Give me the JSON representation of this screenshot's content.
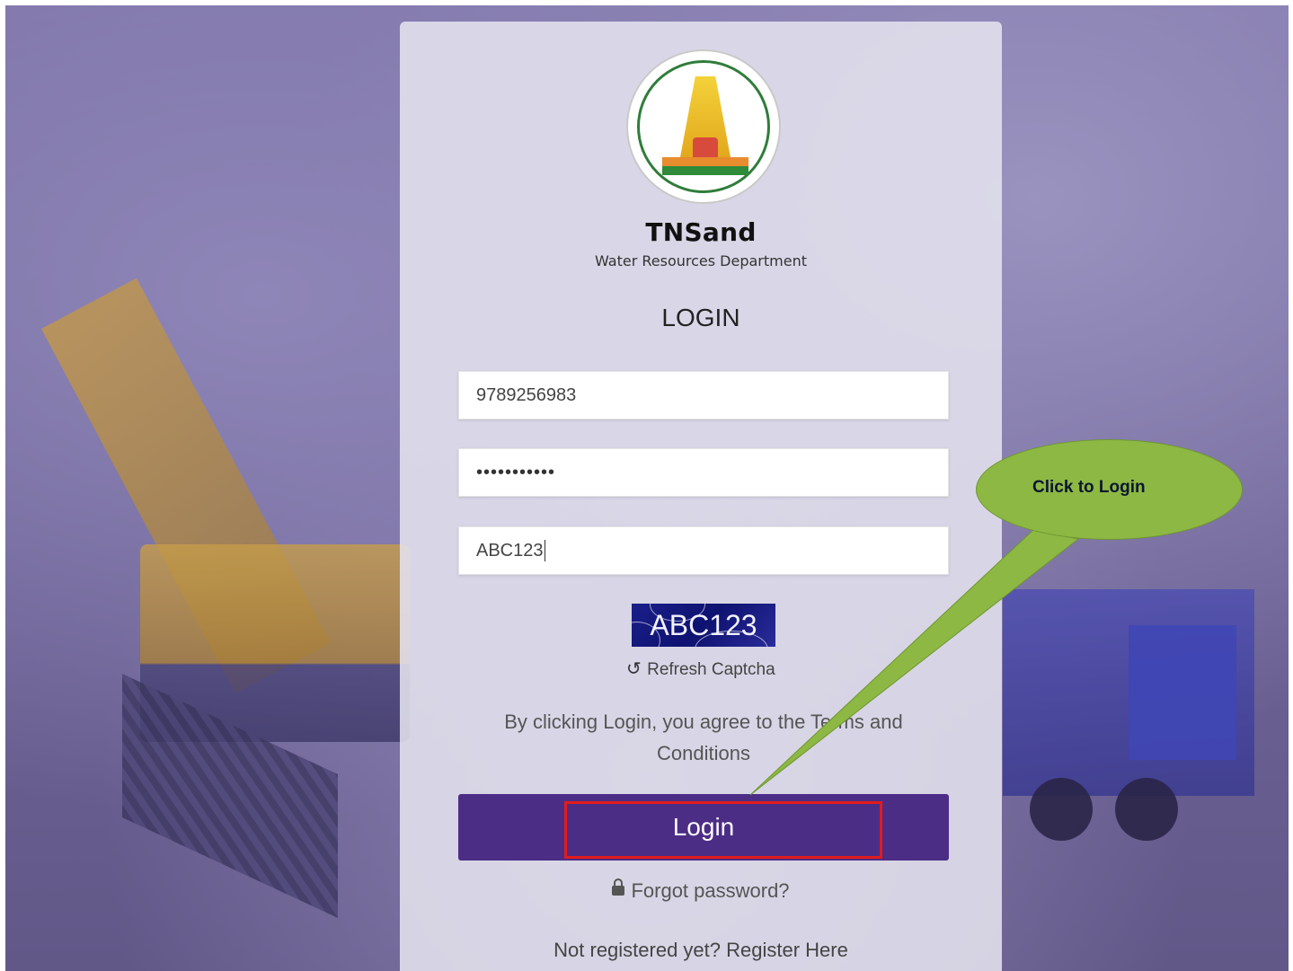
{
  "brand": {
    "title": "TNSand",
    "subtitle": "Water Resources Department"
  },
  "form": {
    "heading": "LOGIN",
    "mobile_value": "9789256983",
    "password_value": "•••••••••••",
    "captcha_input_value": "ABC123",
    "captcha_image_text": "ABC123",
    "refresh_label": "Refresh Captcha",
    "terms_text": "By clicking Login, you agree to the Terms and Conditions",
    "login_label": "Login",
    "forgot_label": "Forgot password?",
    "register_label": "Not registered yet? Register Here"
  },
  "annotation": {
    "callout_text": "Click to Login",
    "callout_color": "#8db843",
    "highlight_color": "#e21b1b"
  },
  "colors": {
    "primary_button": "#4c2d86",
    "background_tint": "#6f6599"
  },
  "icons": {
    "refresh": "refresh-icon",
    "lock": "lock-icon"
  }
}
